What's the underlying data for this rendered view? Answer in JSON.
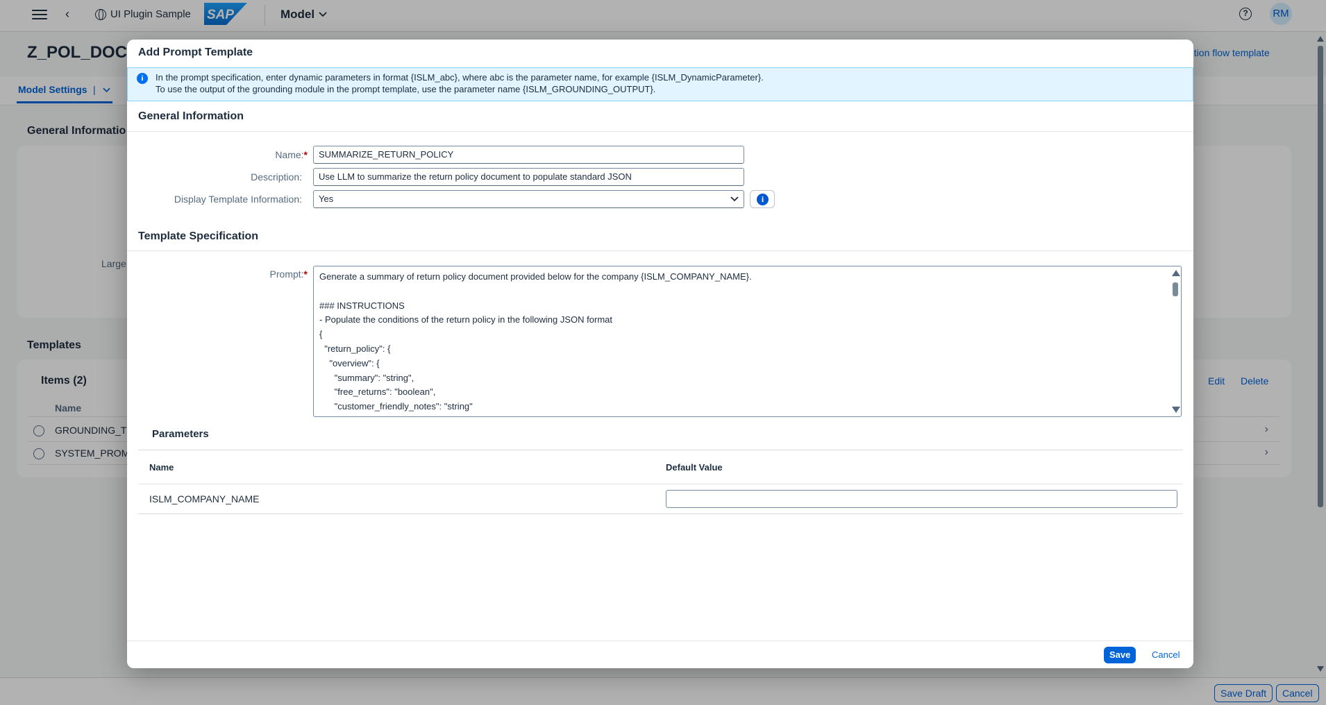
{
  "shell": {
    "app_title": "UI Plugin Sample",
    "logo_text": "SAP",
    "menu_label": "Model",
    "avatar_initials": "RM",
    "help_glyph": "?",
    "icons": [
      "menu-icon",
      "back-icon",
      "globe-icon",
      "chevron-down-icon",
      "help-icon"
    ]
  },
  "background": {
    "page_title": "Z_POL_DOC",
    "right_link": "ution flow template",
    "tab_label": "Model Settings",
    "tab_separator": "|",
    "section_general": "General Informatio",
    "large_label": "Large",
    "section_templates": "Templates",
    "items_title": "Items (2)",
    "edit_label": "Edit",
    "delete_label": "Delete",
    "column_name": "Name",
    "rows": [
      "GROUNDING_TE",
      "SYSTEM_PROMI"
    ],
    "footer": {
      "save_draft": "Save Draft",
      "cancel": "Cancel"
    }
  },
  "dialog": {
    "title": "Add Prompt Template",
    "info_line1": "In the prompt specification, enter dynamic parameters in format {ISLM_abc}, where abc is the parameter name, for example {ISLM_DynamicParameter}.",
    "info_line2": "To use the output of the grounding module in the prompt template, use the parameter name {ISLM_GROUNDING_OUTPUT}.",
    "general_section": "General Information",
    "name_label": "Name:",
    "name_value": "SUMMARIZE_RETURN_POLICY",
    "description_label": "Description:",
    "description_value": "Use LLM to summarize the return policy document to populate standard JSON",
    "display_label": "Display Template Information:",
    "display_value": "Yes",
    "template_section": "Template Specification",
    "prompt_label": "Prompt:",
    "prompt_text": "Generate a summary of return policy document provided below for the company {ISLM_COMPANY_NAME}.\n\n### INSTRUCTIONS\n- Populate the conditions of the return policy in the following JSON format\n{\n  \"return_policy\": {\n    \"overview\": {\n      \"summary\": \"string\",\n      \"free_returns\": \"boolean\",\n      \"customer_friendly_notes\": \"string\"",
    "parameters_title": "Parameters",
    "param_col_name": "Name",
    "param_col_default": "Default Value",
    "param_rows": [
      {
        "name": "ISLM_COMPANY_NAME",
        "default_value": ""
      }
    ],
    "save_label": "Save",
    "cancel_label": "Cancel",
    "required_mark": "*"
  },
  "colors": {
    "accent": "#0064d9",
    "info_bg": "#e1f4ff",
    "required": "#aa0808",
    "sap_logo": "#0a6ed1"
  }
}
